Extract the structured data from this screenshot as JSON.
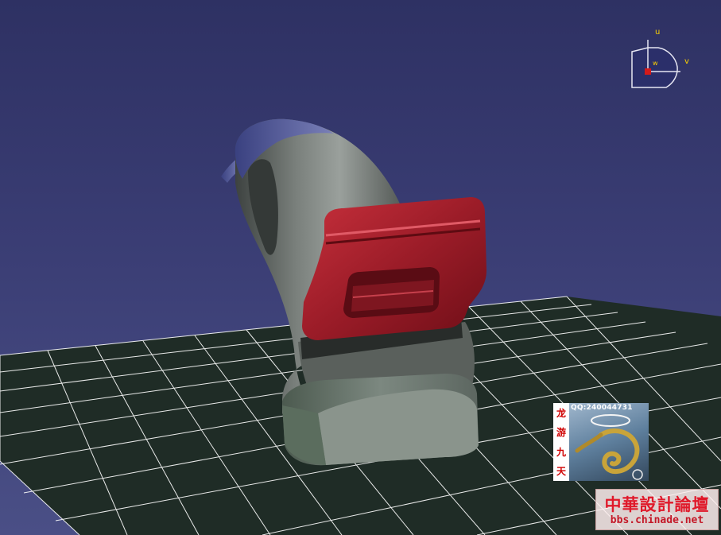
{
  "compass": {
    "u_label": "u",
    "v_label": "v",
    "w_label": "w"
  },
  "logo_badge": {
    "qq_text": "QQ:240044731",
    "chars": [
      "龙",
      "游",
      "九",
      "天"
    ]
  },
  "forum_watermark": {
    "name": "中華設計論壇",
    "url": "bbs.chinade.net"
  },
  "colors": {
    "background": "#3a3d74",
    "grid_fill": "#1f2c26",
    "grid_line": "#ffffff",
    "part_gray": "#6e7470",
    "part_red": "#a3202c",
    "part_blue": "#4c55a0"
  },
  "icons": {
    "compass": "compass-icon",
    "dragon": "dragon-icon"
  }
}
